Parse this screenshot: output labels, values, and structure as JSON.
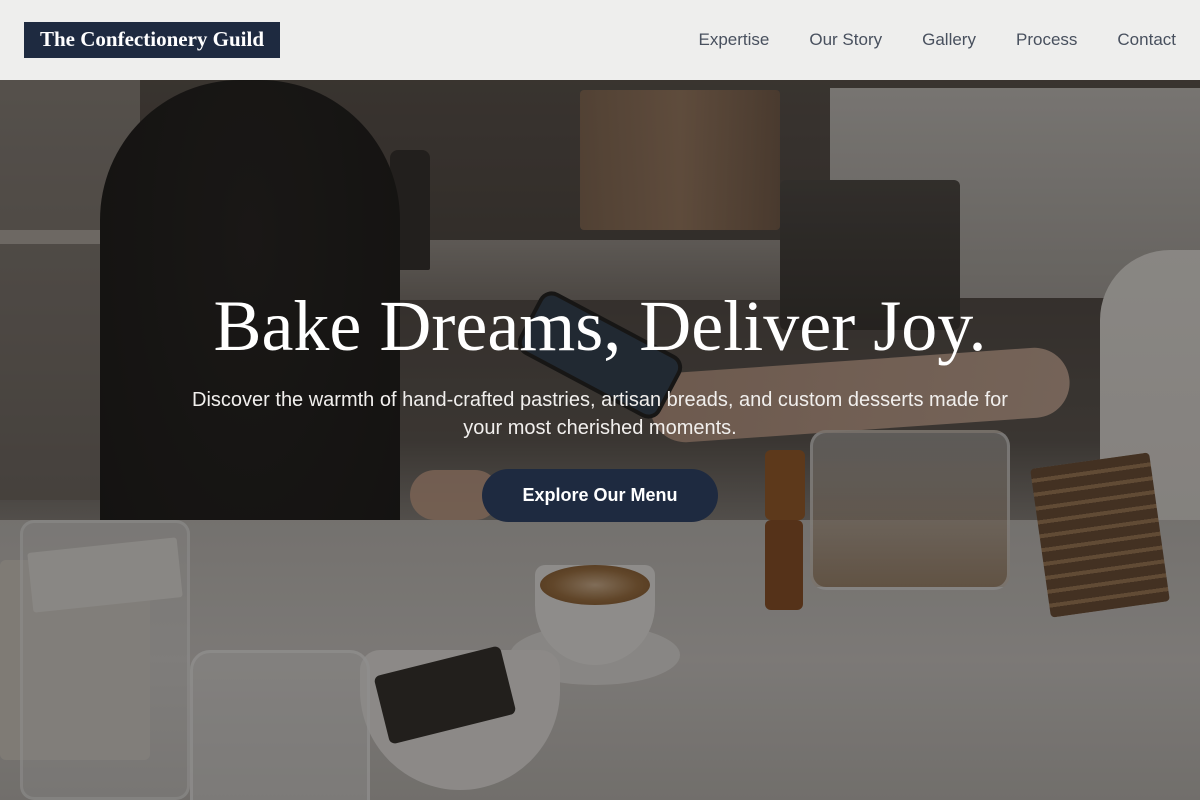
{
  "header": {
    "brand": "The Confectionery Guild",
    "nav": [
      {
        "label": "Expertise"
      },
      {
        "label": "Our Story"
      },
      {
        "label": "Gallery"
      },
      {
        "label": "Process"
      },
      {
        "label": "Contact"
      }
    ]
  },
  "hero": {
    "title": "Bake Dreams, Deliver Joy.",
    "subtitle": "Discover the warmth of hand-crafted pastries, artisan breads, and custom desserts made for your most cherished moments.",
    "cta_label": "Explore Our Menu"
  },
  "colors": {
    "brand_navy": "#1e2a40",
    "header_bg": "#f6f6f5",
    "nav_text": "#48505e",
    "hero_text": "#ffffff"
  }
}
